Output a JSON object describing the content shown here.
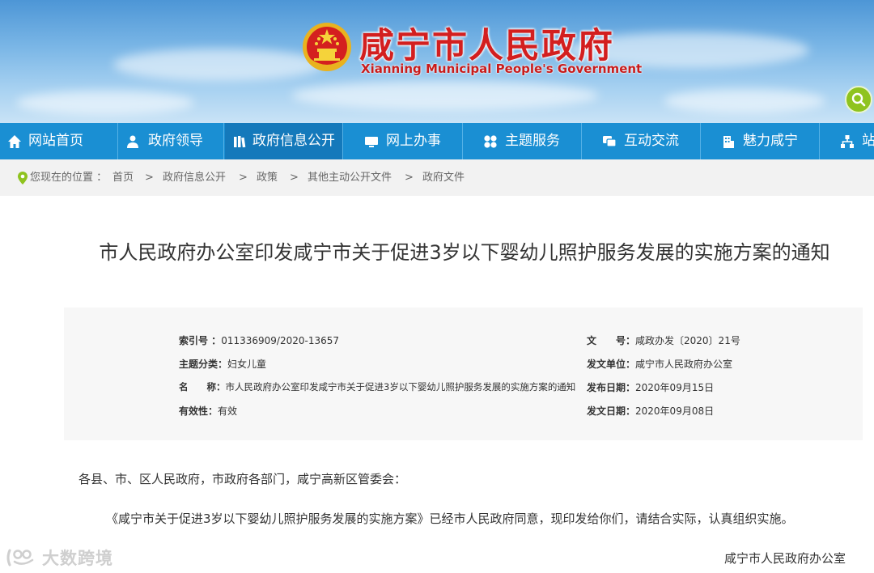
{
  "header": {
    "title": "咸宁市人民政府",
    "subtitle": "Xianning Municipal People's Government",
    "emblem_icon": "national-emblem",
    "search_icon": "search-icon",
    "colors": {
      "title": "#d31f1f",
      "sky": "#4d96d6",
      "search": "#8fc31f"
    }
  },
  "nav": {
    "color": "#1a8fd3",
    "items": [
      {
        "label": "网站首页",
        "icon": "home-icon"
      },
      {
        "label": "政府领导",
        "icon": "people-icon"
      },
      {
        "label": "政府信息公开",
        "icon": "books-icon",
        "active": true
      },
      {
        "label": "网上办事",
        "icon": "monitor-icon"
      },
      {
        "label": "主题服务",
        "icon": "grid-icon"
      },
      {
        "label": "互动交流",
        "icon": "chat-icon"
      },
      {
        "label": "魅力咸宁",
        "icon": "building-icon"
      },
      {
        "label": "站",
        "icon": "sitemap-icon"
      }
    ]
  },
  "breadcrumb": {
    "prefix": "您现在的位置 ：",
    "separator": ">",
    "items": [
      "首页",
      "政府信息公开",
      "政策",
      "其他主动公开文件",
      "政府文件"
    ]
  },
  "article": {
    "title": "市人民政府办公室印发咸宁市关于促进3岁以下婴幼儿照护服务发展的实施方案的通知",
    "meta": {
      "index_label": "索引号 ：",
      "index_value": "011336909/2020-13657",
      "doc_no_label": "文　　号：",
      "doc_no_value": "咸政办发〔2020〕21号",
      "topic_label": "主题分类：",
      "topic_value": "妇女儿童",
      "issuer_label": "发文单位：",
      "issuer_value": "咸宁市人民政府办公室",
      "name_label": "名　　称：",
      "name_value": "市人民政府办公室印发咸宁市关于促进3岁以下婴幼儿照护服务发展的实施方案的通知",
      "publish_label": "发布日期：",
      "publish_value": "2020年09月15日",
      "validity_label": "有效性：",
      "validity_value": "有效",
      "issue_label": "发文日期：",
      "issue_value": "2020年09月08日"
    },
    "recipients": "各县、市、区人民政府，市政府各部门，咸宁高新区管委会：",
    "body": "《咸宁市关于促进3岁以下婴幼儿照护服务发展的实施方案》已经市人民政府同意，现印发给你们，请结合实际，认真组织实施。",
    "signer": "咸宁市人民政府办公室"
  },
  "watermark": {
    "text": "大数跨境",
    "icon": "watermark-logo-icon"
  }
}
